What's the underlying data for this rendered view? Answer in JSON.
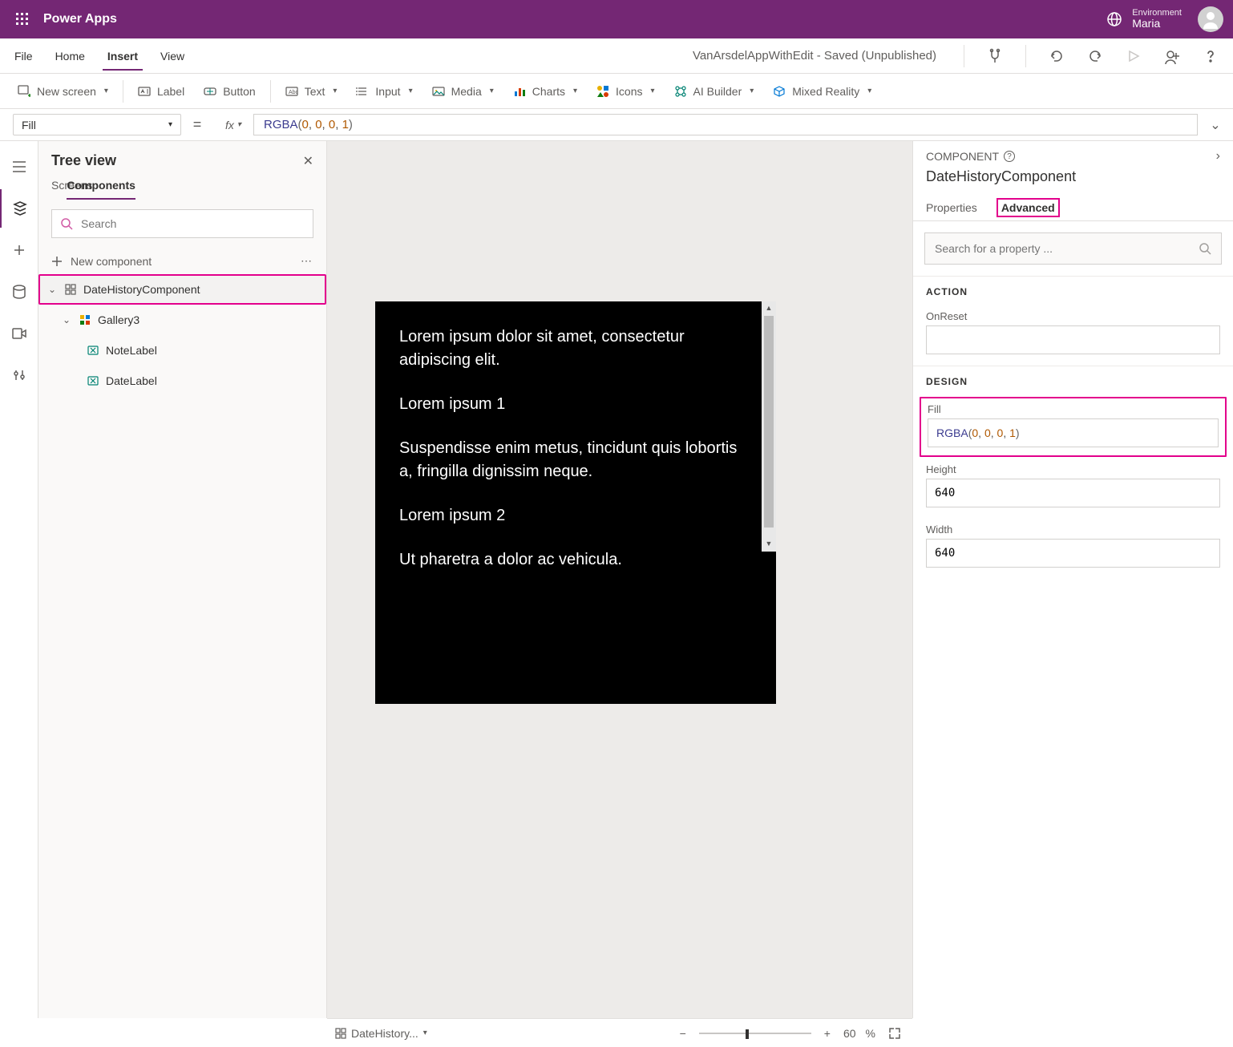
{
  "header": {
    "title": "Power Apps",
    "env_label": "Environment",
    "env_name": "Maria"
  },
  "menubar": {
    "items": [
      "File",
      "Home",
      "Insert",
      "View"
    ],
    "active_index": 2,
    "status": "VanArsdelAppWithEdit - Saved (Unpublished)"
  },
  "ribbon": {
    "new_screen": "New screen",
    "label": "Label",
    "button": "Button",
    "text": "Text",
    "input": "Input",
    "media": "Media",
    "charts": "Charts",
    "icons": "Icons",
    "ai_builder": "AI Builder",
    "mixed_reality": "Mixed Reality"
  },
  "formula": {
    "property": "Fill",
    "fn": "RGBA",
    "args": [
      "0",
      "0",
      "0",
      "1"
    ]
  },
  "tree": {
    "title": "Tree view",
    "tabs": [
      "Screens",
      "Components"
    ],
    "active_tab": 1,
    "search_placeholder": "Search",
    "new_component": "New component",
    "nodes": {
      "component": "DateHistoryComponent",
      "gallery": "Gallery3",
      "note": "NoteLabel",
      "date": "DateLabel"
    }
  },
  "canvas": {
    "lines": [
      "Lorem ipsum dolor sit amet, consectetur adipiscing elit.",
      "Lorem ipsum 1",
      "Suspendisse enim metus, tincidunt quis lobortis a, fringilla dignissim neque.",
      "Lorem ipsum 2",
      "Ut pharetra a dolor ac vehicula."
    ]
  },
  "proppane": {
    "header": "COMPONENT",
    "name": "DateHistoryComponent",
    "tabs": [
      "Properties",
      "Advanced"
    ],
    "active_tab": 1,
    "search_placeholder": "Search for a property ...",
    "sections": {
      "action": "ACTION",
      "design": "DESIGN"
    },
    "fields": {
      "onreset": {
        "label": "OnReset",
        "value": ""
      },
      "fill": {
        "label": "Fill",
        "fn": "RGBA",
        "args": [
          "0",
          "0",
          "0",
          "1"
        ]
      },
      "height": {
        "label": "Height",
        "value": "640"
      },
      "width": {
        "label": "Width",
        "value": "640"
      }
    }
  },
  "footer": {
    "selected": "DateHistory...",
    "zoom": "60",
    "zoom_unit": "%"
  }
}
